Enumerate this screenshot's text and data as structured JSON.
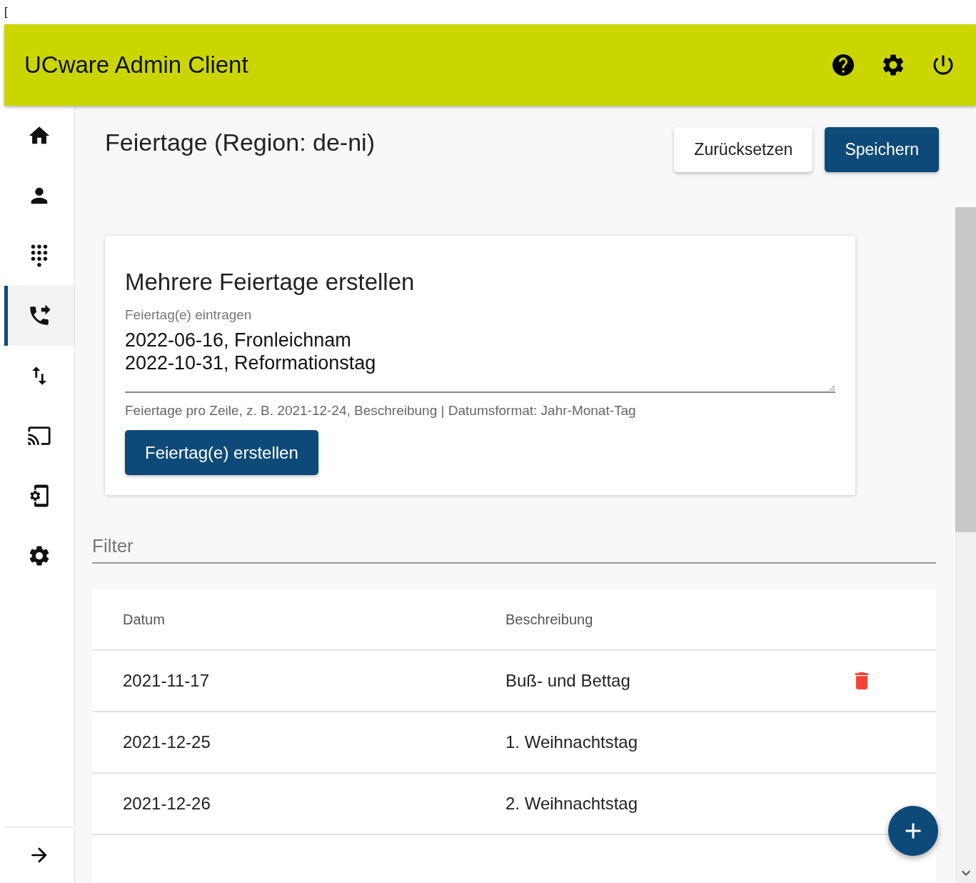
{
  "page_prefix": "[",
  "app_bar": {
    "title": "UCware Admin Client",
    "actions": [
      {
        "kind": "help"
      },
      {
        "kind": "settings"
      },
      {
        "kind": "power"
      }
    ]
  },
  "sidebar": {
    "items": [
      {
        "kind": "home",
        "selected": false
      },
      {
        "kind": "person",
        "selected": false
      },
      {
        "kind": "dialpad",
        "selected": false
      },
      {
        "kind": "phone-forward",
        "selected": true
      },
      {
        "kind": "swap",
        "selected": false
      },
      {
        "kind": "cast",
        "selected": false
      },
      {
        "kind": "device-settings",
        "selected": false
      },
      {
        "kind": "settings",
        "selected": false
      }
    ],
    "collapse": {
      "kind": "arrow"
    }
  },
  "page": {
    "title": "Feiertage (Region: de-ni)",
    "buttons": [
      {
        "label": "Zurücksetzen",
        "kind": "secondary"
      },
      {
        "label": "Speichern",
        "kind": "primary"
      }
    ]
  },
  "create_card": {
    "title": "Mehrere Feiertage erstellen",
    "field_label": "Feiertag(e) eintragen",
    "value": "2022-06-16, Fronleichnam\n2022-10-31, Reformationstag",
    "hint": "Feiertage pro Zeile, z. B. 2021-12-24, Beschreibung | Datumsformat: Jahr-Monat-Tag",
    "button": "Feiertag(e) erstellen"
  },
  "filter": {
    "placeholder": "Filter"
  },
  "table": {
    "columns": [
      "Datum",
      "Beschreibung"
    ],
    "rows": [
      {
        "date": "2021-11-17",
        "description": "Buß- und Bettag",
        "delete_shown": true
      },
      {
        "date": "2021-12-25",
        "description": "1. Weihnachtstag",
        "delete_shown": false
      },
      {
        "date": "2021-12-26",
        "description": "2. Weihnachtstag",
        "delete_shown": false
      }
    ]
  },
  "fab": {
    "kind": "add"
  }
}
